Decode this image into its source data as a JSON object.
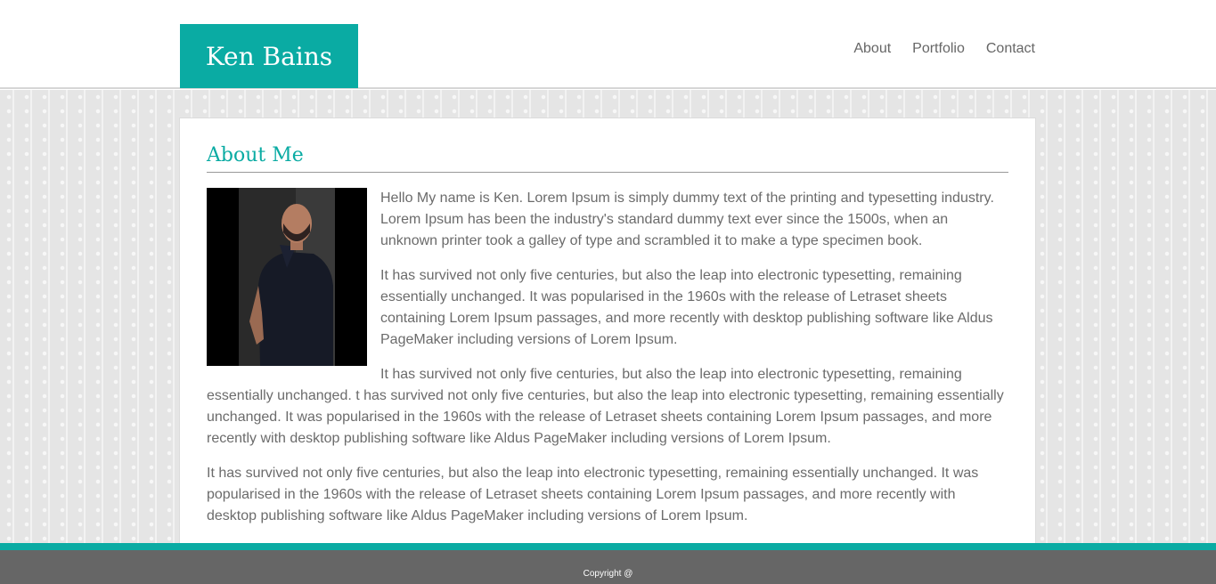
{
  "header": {
    "logo": "Ken Bains",
    "nav": [
      {
        "label": "About"
      },
      {
        "label": "Portfolio"
      },
      {
        "label": "Contact"
      }
    ]
  },
  "main": {
    "title": "About Me",
    "photo_icon": "person-photo",
    "paragraphs": [
      "Hello My name is Ken. Lorem Ipsum is simply dummy text of the printing and typesetting industry. Lorem Ipsum has been the industry's standard dummy text ever since the 1500s, when an unknown printer took a galley of type and scrambled it to make a type specimen book.",
      "It has survived not only five centuries, but also the leap into electronic typesetting, remaining essentially unchanged. It was popularised in the 1960s with the release of Letraset sheets containing Lorem Ipsum passages, and more recently with desktop publishing software like Aldus PageMaker including versions of Lorem Ipsum.",
      "It has survived not only five centuries, but also the leap into electronic typesetting, remaining essentially unchanged. t has survived not only five centuries, but also the leap into electronic typesetting, remaining essentially unchanged. It was popularised in the 1960s with the release of Letraset sheets containing Lorem Ipsum passages, and more recently with desktop publishing software like Aldus PageMaker including versions of Lorem Ipsum.",
      "It has survived not only five centuries, but also the leap into electronic typesetting, remaining essentially unchanged. It was popularised in the 1960s with the release of Letraset sheets containing Lorem Ipsum passages, and more recently with desktop publishing software like Aldus PageMaker including versions of Lorem Ipsum."
    ]
  },
  "footer": {
    "copyright": "Copyright @"
  },
  "colors": {
    "accent": "#0aaba3",
    "footer": "#666666",
    "text": "#6b6b6b"
  }
}
